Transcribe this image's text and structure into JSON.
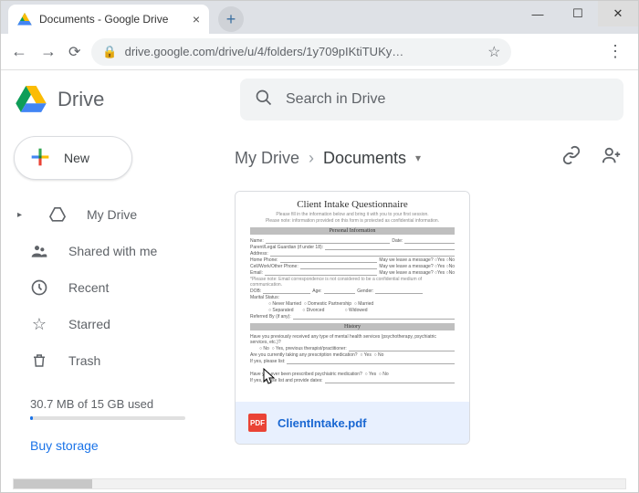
{
  "browser": {
    "tab_title": "Documents - Google Drive",
    "url_display": "drive.google.com/drive/u/4/folders/1y709pIKtiTUKy…"
  },
  "app": {
    "product_name": "Drive",
    "search_placeholder": "Search in Drive"
  },
  "sidebar": {
    "new_label": "New",
    "items": [
      {
        "label": "My Drive",
        "icon": "my-drive-icon",
        "expandable": true
      },
      {
        "label": "Shared with me",
        "icon": "shared-icon"
      },
      {
        "label": "Recent",
        "icon": "recent-icon"
      },
      {
        "label": "Starred",
        "icon": "starred-icon"
      },
      {
        "label": "Trash",
        "icon": "trash-icon"
      }
    ],
    "storage_text": "30.7 MB of 15 GB used",
    "buy_storage_label": "Buy storage"
  },
  "breadcrumb": {
    "root": "My Drive",
    "current": "Documents"
  },
  "files": [
    {
      "name": "ClientIntake.pdf",
      "type": "pdf",
      "selected": true,
      "preview_title": "Client Intake Questionnaire",
      "preview_sections": [
        "Personal Information",
        "History"
      ]
    }
  ],
  "colors": {
    "accent": "#1a73e8",
    "selected_bg": "#e8f0fe",
    "pdf": "#ea4335"
  }
}
